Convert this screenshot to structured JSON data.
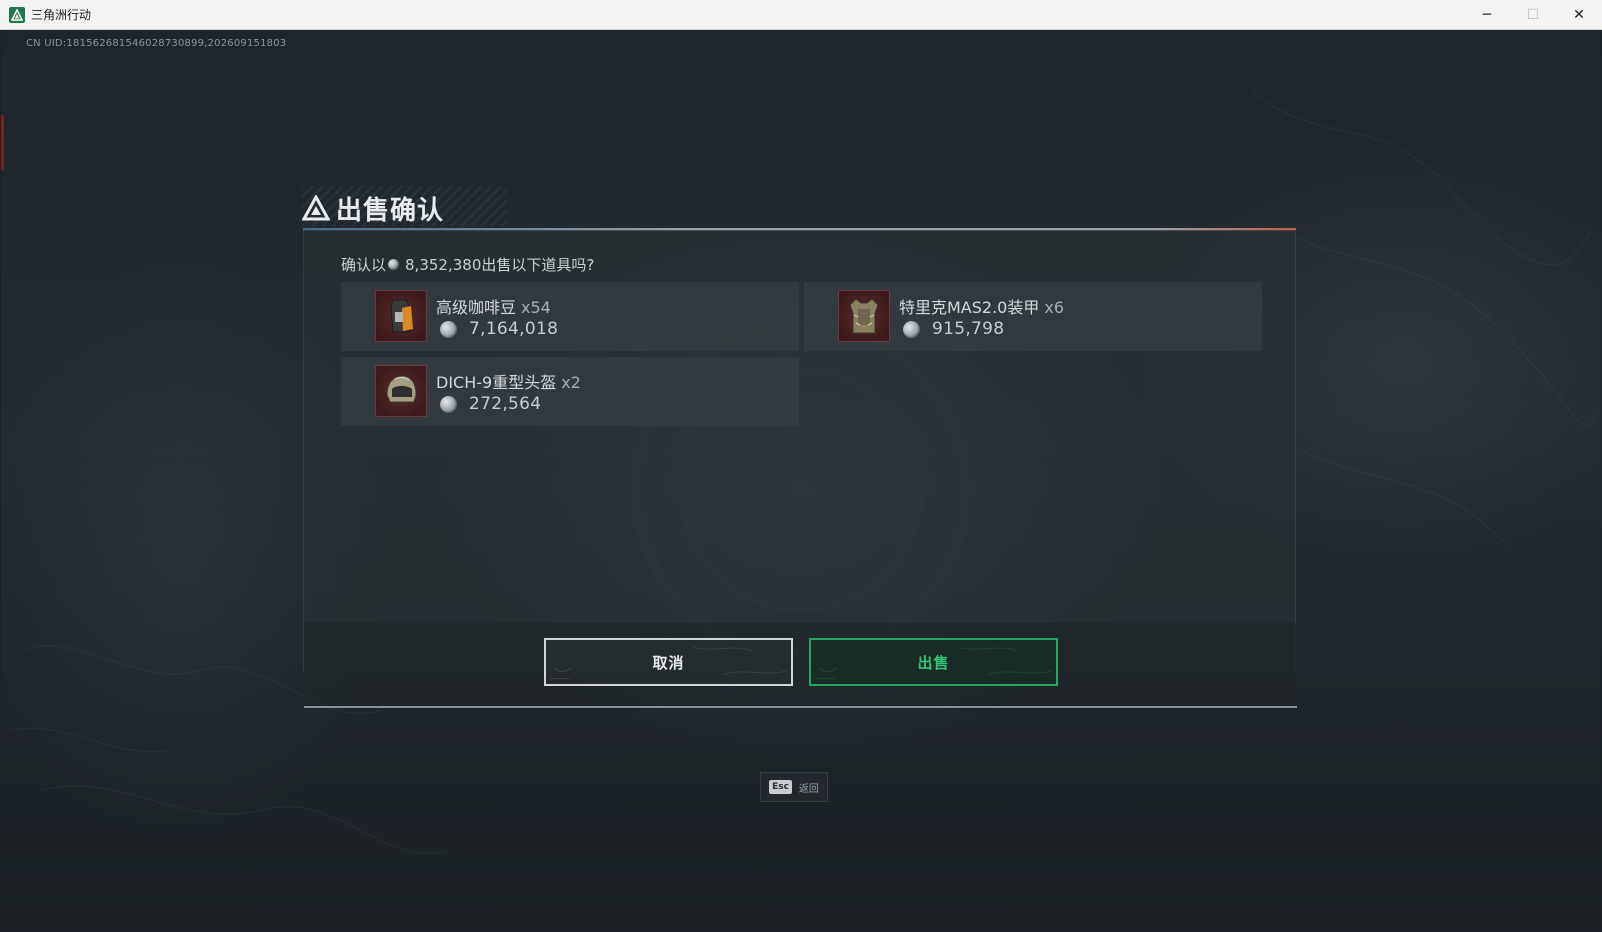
{
  "window": {
    "title": "三角洲行动",
    "controls": {
      "minimize": "─",
      "maximize": "☐",
      "close": "✕"
    }
  },
  "game": {
    "uid_text": "CN UID:1815626815460287308​99,202609151803"
  },
  "dialog": {
    "title": "出售确认",
    "confirm_prefix": "确认以",
    "total_price": "8,352,380",
    "confirm_suffix": "出售以下道具吗?",
    "items": [
      {
        "name": "高级咖啡豆",
        "qty": "x54",
        "price": "7,164,018",
        "icon": "coffee-beans-icon"
      },
      {
        "name": "特里克MAS2.0装甲",
        "qty": "x6",
        "price": "915,798",
        "icon": "armor-vest-icon"
      },
      {
        "name": "DICH-9重型头盔",
        "qty": "x2",
        "price": "272,564",
        "icon": "helmet-icon"
      }
    ],
    "buttons": {
      "cancel": "取消",
      "sell": "出售"
    }
  },
  "esc_hint": {
    "key": "Esc",
    "label": "返回"
  },
  "colors": {
    "accent_green": "#32c774",
    "thumb_red": "#3c1a1d"
  }
}
